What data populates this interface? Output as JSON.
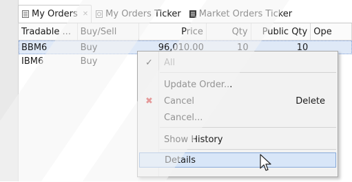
{
  "tabs": [
    {
      "label": "My Orders",
      "close": "✕",
      "active": true,
      "icon": "orders-icon"
    },
    {
      "label": "My Orders Ticker",
      "active": false,
      "icon": "ticker-icon"
    },
    {
      "label": "Market Orders Ticker",
      "active": false,
      "icon": "market-icon"
    }
  ],
  "table": {
    "columns": [
      "Tradable ...",
      "Buy/Sell",
      "Price",
      "Qty",
      "Public Qty",
      "Ope"
    ],
    "rows": [
      {
        "tradable": "BBM6",
        "side": "Buy",
        "price": "96,010.00",
        "qty": "10",
        "public_qty": "10",
        "open": ""
      },
      {
        "tradable": "IBM6",
        "side": "Buy",
        "price": "",
        "qty": "",
        "public_qty": "",
        "open": ""
      }
    ]
  },
  "context_menu": {
    "items": [
      {
        "label": "All",
        "icon": "✓",
        "disabled": true
      },
      {
        "label": "Update Order...",
        "icon": ""
      },
      {
        "label": "Cancel",
        "icon": "✖",
        "accelerator": "Delete"
      },
      {
        "label": "Cancel...",
        "icon": ""
      },
      {
        "label": "Show History",
        "icon": ""
      },
      {
        "label": "Details",
        "icon": "",
        "hot": true
      }
    ]
  },
  "colors": {
    "selection": "#dfe9f7",
    "menu_hot": "#d8e6f8",
    "cancel_icon": "#d22b2b"
  }
}
